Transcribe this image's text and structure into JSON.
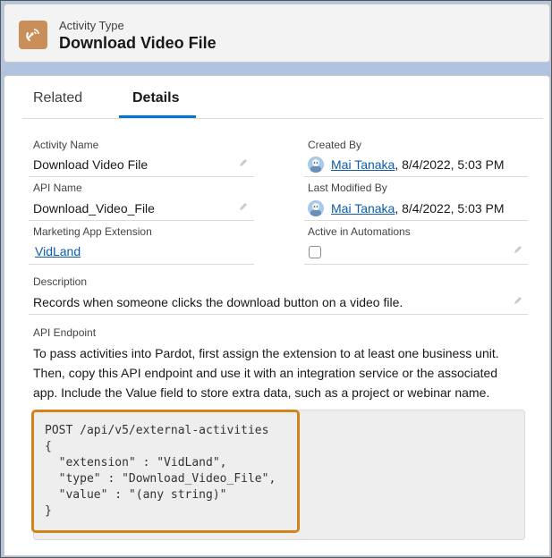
{
  "header": {
    "object_label": "Activity Type",
    "record_title": "Download Video File",
    "icon": "satellite-dish-icon",
    "icon_color": "#c98f5a"
  },
  "tabs": [
    {
      "label": "Related",
      "active": false
    },
    {
      "label": "Details",
      "active": true
    }
  ],
  "fields": {
    "activity_name": {
      "label": "Activity Name",
      "value": "Download Video File"
    },
    "api_name": {
      "label": "API Name",
      "value": "Download_Video_File"
    },
    "marketing_app_extension": {
      "label": "Marketing App Extension",
      "value": "VidLand"
    },
    "created_by": {
      "label": "Created By",
      "user": "Mai Tanaka",
      "datetime": ", 8/4/2022, 5:03 PM"
    },
    "last_modified_by": {
      "label": "Last Modified By",
      "user": "Mai Tanaka",
      "datetime": ", 8/4/2022, 5:03 PM"
    },
    "active_in_automations": {
      "label": "Active in Automations",
      "checked": false
    },
    "description": {
      "label": "Description",
      "value": "Records when someone clicks the download button on a video file."
    },
    "api_endpoint": {
      "label": "API Endpoint",
      "text": "To pass activities into Pardot, first assign the extension to at least one business unit. Then, copy this API endpoint and use it with an integration service or the associated app. Include the Value field to store extra data, such as a project or webinar name.",
      "code": "POST /api/v5/external-activities\n{\n  \"extension\" : \"VidLand\",\n  \"type\" : \"Download_Video_File\",\n  \"value\" : \"(any string)\"\n}"
    }
  },
  "colors": {
    "accent": "#0176d3",
    "highlight": "#d4831a",
    "link": "#0b5cab"
  }
}
